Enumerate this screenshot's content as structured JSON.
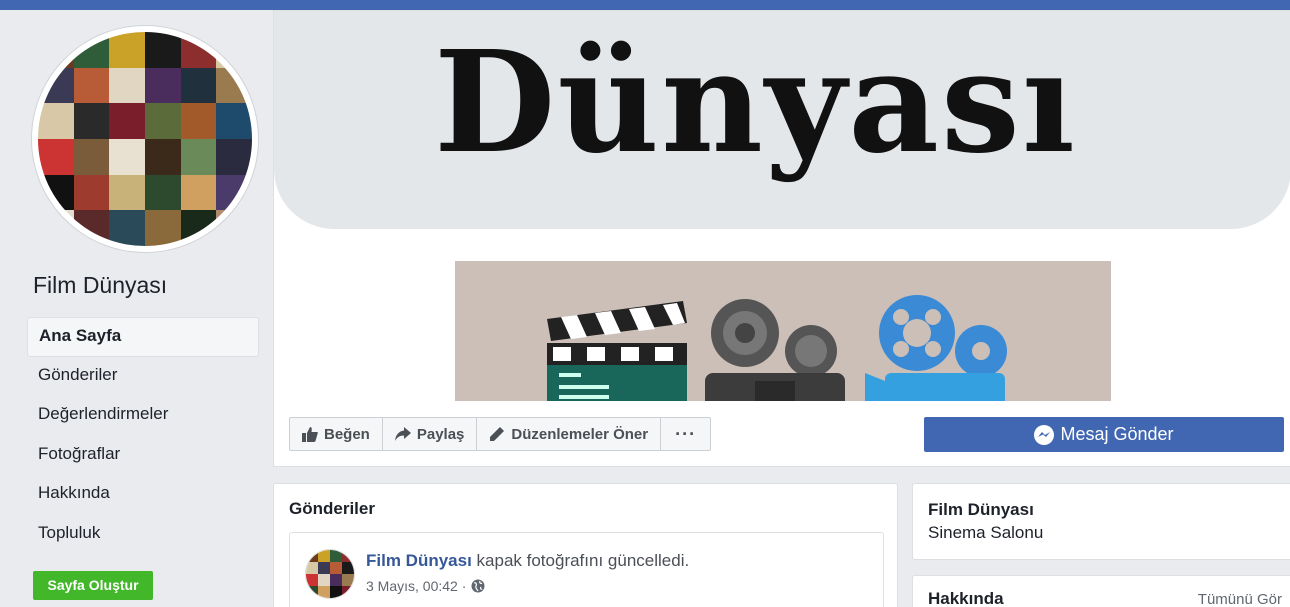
{
  "colors": {
    "brand": "#4267b2",
    "create_button": "#42b72a",
    "link": "#365899"
  },
  "page": {
    "name": "Film Dünyası",
    "category": "Sinema Salonu"
  },
  "sidebar": {
    "items": [
      {
        "label": "Ana Sayfa",
        "active": true
      },
      {
        "label": "Gönderiler"
      },
      {
        "label": "Değerlendirmeler"
      },
      {
        "label": "Fotoğraflar"
      },
      {
        "label": "Hakkında"
      },
      {
        "label": "Topluluk"
      }
    ],
    "create_page_label": "Sayfa Oluştur"
  },
  "cover": {
    "banner_text": "Dünyası"
  },
  "actions": {
    "like": {
      "label": "Beğen",
      "icon": "thumbs-up-icon"
    },
    "share": {
      "label": "Paylaş",
      "icon": "share-arrow-icon"
    },
    "suggest": {
      "label": "Düzenlemeler Öner",
      "icon": "pencil-icon"
    },
    "more": {
      "label": "···",
      "icon": "more-icon"
    },
    "message": {
      "label": "Mesaj Gönder",
      "icon": "messenger-icon"
    }
  },
  "posts": {
    "title": "Gönderiler",
    "items": [
      {
        "author": "Film Dünyası",
        "text": "kapak fotoğrafını güncelledi.",
        "time": "3 Mayıs, 00:42 ·",
        "privacy_icon": "globe-icon"
      }
    ]
  },
  "about": {
    "title": "Hakkında",
    "see_all": "Tümünü Gör"
  }
}
